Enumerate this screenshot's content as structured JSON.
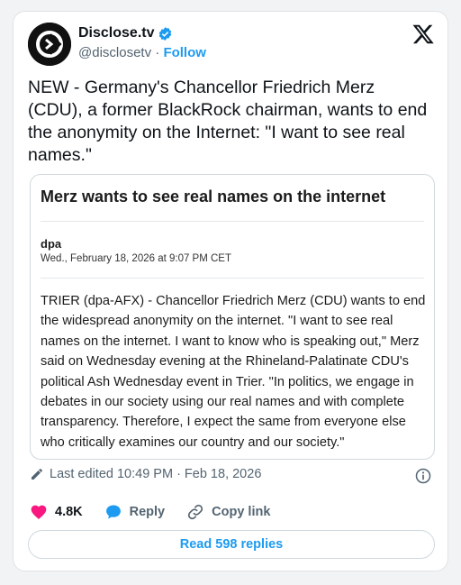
{
  "author": {
    "name": "Disclose.tv",
    "handle": "@disclosetv",
    "separator": "·",
    "follow_label": "Follow"
  },
  "tweet": {
    "text": "NEW - Germany's Chancellor Friedrich Merz (CDU), a former BlackRock chairman, wants to end the anonymity on the Internet: \"I want to see real names.\""
  },
  "article": {
    "title": "Merz wants to see real names on the internet",
    "source": "dpa",
    "date": "Wed., February 18, 2026 at 9:07 PM CET",
    "body": "TRIER (dpa-AFX) - Chancellor Friedrich Merz (CDU) wants to end the widespread anonymity on the internet. \"I want to see real names on the internet. I want to know who is speaking out,\" Merz said on Wednesday evening at the Rhineland-Palatinate CDU's political Ash Wednesday event in Trier. \"In politics, we engage in debates in our society using our real names and with complete transparency. Therefore, I expect the same from everyone else who critically examines our country and our society.\""
  },
  "meta": {
    "edited_text": "Last edited 10:49 PM · Feb 18, 2026"
  },
  "actions": {
    "likes": "4.8K",
    "reply_label": "Reply",
    "copy_link_label": "Copy link",
    "read_replies_label": "Read 598 replies"
  },
  "icons": {
    "verified": "verified-badge-icon",
    "x_logo": "x-logo-icon",
    "pencil": "pencil-icon",
    "info": "info-icon",
    "heart": "heart-icon",
    "reply": "speech-bubble-icon",
    "link": "link-icon"
  },
  "colors": {
    "accent": "#1d9bf0",
    "heart": "#f91880",
    "text": "#0f1419",
    "muted": "#536471"
  }
}
